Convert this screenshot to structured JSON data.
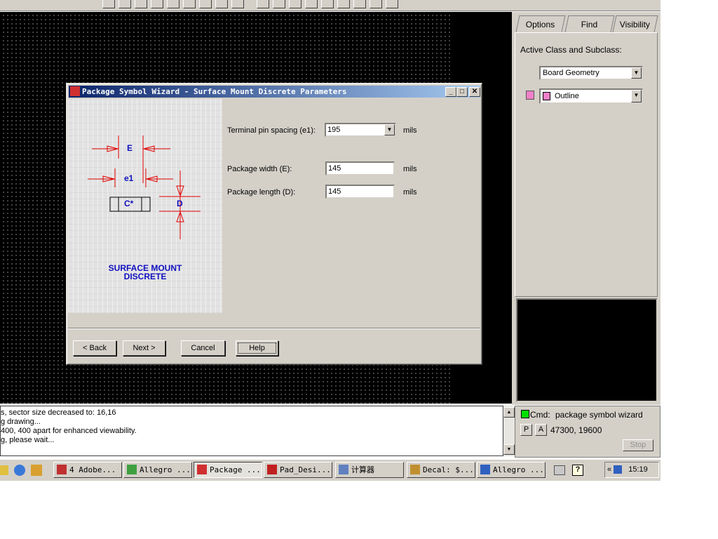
{
  "toolbar": {
    "icons": [
      "route-icon",
      "grid-icon",
      "shape-icon",
      "pointer-icon",
      "copy-icon",
      "move-icon",
      "rect-icon",
      "arc-icon",
      "delete-icon",
      "add-line-icon",
      "add-frame-icon",
      "text-icon",
      "dimension-icon",
      "slide-icon",
      "circle-icon",
      "arc-draw-icon",
      "angle-icon",
      "curve-icon"
    ]
  },
  "panel": {
    "tabs": [
      "Options",
      "Find",
      "Visibility"
    ],
    "active_label": "Active Class and Subclass:",
    "class_value": "Board Geometry",
    "subclass_value": "Outline",
    "subclass_color": "#f080c8"
  },
  "cmdlog": {
    "lines": [
      "s, sector size decreased to: 16,16",
      "g drawing...",
      "400, 400 apart for enhanced viewability.",
      "g, please wait..."
    ]
  },
  "status": {
    "cmd_label": "Cmd:",
    "cmd_value": "package symbol wizard",
    "p_label": "P",
    "a_label": "A",
    "coords": "47300, 19600",
    "stop_label": "Stop",
    "indicator_color": "#00e000"
  },
  "taskbar": {
    "items": [
      "4 Adobe...",
      "Allegro ...",
      "Package ...",
      "Pad_Desi...",
      "计算器",
      "Decal: $...",
      "Allegro ..."
    ],
    "clock": "15:19"
  },
  "dialog": {
    "title": "Package Symbol Wizard - Surface Mount Discrete Parameters",
    "art": {
      "E": "E",
      "e1": "e1",
      "body": "C*",
      "D": "D",
      "caption1": "SURFACE MOUNT",
      "caption2": "DISCRETE"
    },
    "fields": [
      {
        "label": "Terminal pin spacing (e1):",
        "value": "195",
        "unit": "mils"
      },
      {
        "label": "Package width (E):",
        "value": "145",
        "unit": "mils"
      },
      {
        "label": "Package length (D):",
        "value": "145",
        "unit": "mils"
      }
    ],
    "buttons": {
      "back": "< Back",
      "next": "Next >",
      "cancel": "Cancel",
      "help": "Help"
    }
  }
}
